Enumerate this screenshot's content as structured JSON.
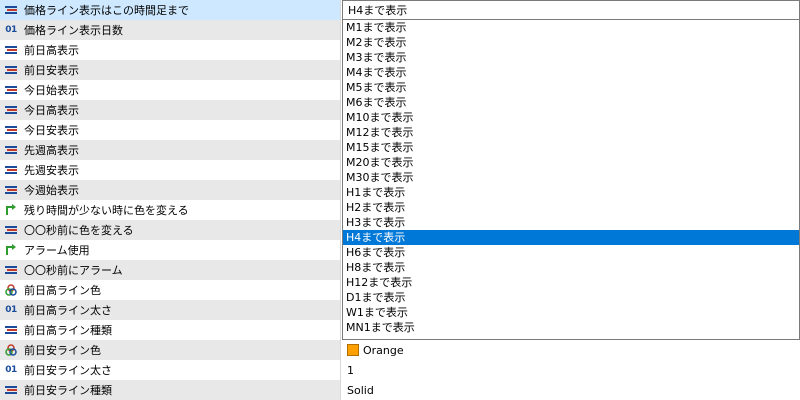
{
  "rows": [
    {
      "icon": "enum-list-icon",
      "label": "価格ライン表示はこの時間足まで",
      "value": "H4まで表示"
    },
    {
      "icon": "integer-01-icon",
      "label": "価格ライン表示日数",
      "value": ""
    },
    {
      "icon": "enum-list-icon",
      "label": "前日高表示",
      "value": ""
    },
    {
      "icon": "enum-list-icon",
      "label": "前日安表示",
      "value": ""
    },
    {
      "icon": "enum-list-icon",
      "label": "今日始表示",
      "value": ""
    },
    {
      "icon": "enum-list-icon",
      "label": "今日高表示",
      "value": ""
    },
    {
      "icon": "enum-list-icon",
      "label": "今日安表示",
      "value": ""
    },
    {
      "icon": "enum-list-icon",
      "label": "先週高表示",
      "value": ""
    },
    {
      "icon": "enum-list-icon",
      "label": "先週安表示",
      "value": ""
    },
    {
      "icon": "enum-list-icon",
      "label": "今週始表示",
      "value": ""
    },
    {
      "icon": "bool-arrow-icon",
      "label": "残り時間が少ない時に色を変える",
      "value": ""
    },
    {
      "icon": "enum-list-icon",
      "label": "〇〇秒前に色を変える",
      "value": ""
    },
    {
      "icon": "bool-arrow-icon",
      "label": "アラーム使用",
      "value": ""
    },
    {
      "icon": "enum-list-icon",
      "label": "〇〇秒前にアラーム",
      "value": ""
    },
    {
      "icon": "color-circles-icon",
      "label": "前日高ライン色",
      "value": ""
    },
    {
      "icon": "integer-01-icon",
      "label": "前日高ライン太さ",
      "value": ""
    },
    {
      "icon": "enum-list-icon",
      "label": "前日高ライン種類",
      "value": ""
    },
    {
      "icon": "color-circles-icon",
      "label": "前日安ライン色",
      "value": "Orange",
      "swatch": "#ffa000"
    },
    {
      "icon": "integer-01-icon",
      "label": "前日安ライン太さ",
      "value": "1"
    },
    {
      "icon": "enum-list-icon",
      "label": "前日安ライン種類",
      "value": "Solid"
    }
  ],
  "dropdown": {
    "selected": "H4まで表示",
    "options": [
      "M1まで表示",
      "M2まで表示",
      "M3まで表示",
      "M4まで表示",
      "M5まで表示",
      "M6まで表示",
      "M10まで表示",
      "M12まで表示",
      "M15まで表示",
      "M20まで表示",
      "M30まで表示",
      "H1まで表示",
      "H2まで表示",
      "H3まで表示",
      "H4まで表示",
      "H6まで表示",
      "H8まで表示",
      "H12まで表示",
      "D1まで表示",
      "W1まで表示",
      "MN1まで表示"
    ]
  },
  "colors": {
    "highlight": "#0078d7",
    "row_alt": "#e8e8e8",
    "orange_swatch": "#ffa000"
  }
}
